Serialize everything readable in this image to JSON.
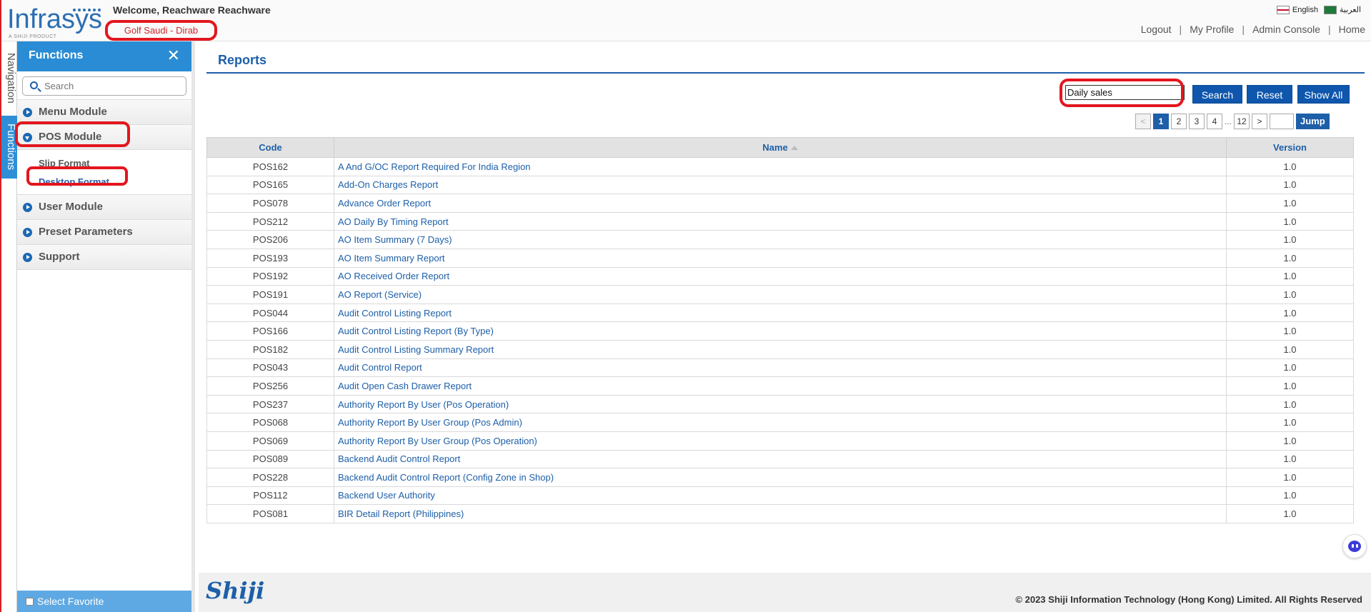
{
  "header": {
    "brand": "Infrasys",
    "brand_tag": "A SHIJI PRODUCT",
    "welcome": "Welcome, Reachware Reachware",
    "outlet": "Golf Saudi - Dirab",
    "languages": [
      "English",
      "العربية"
    ],
    "nav": [
      "Logout",
      "My Profile",
      "Admin Console",
      "Home"
    ]
  },
  "vtabs": {
    "navigation": "Navigation",
    "functions": "Functions"
  },
  "sidebar": {
    "title": "Functions",
    "search_placeholder": "Search",
    "modules": [
      {
        "label": "Menu Module",
        "open": false
      },
      {
        "label": "POS Module",
        "open": true,
        "items": [
          "Slip Format",
          "Desktop Format"
        ],
        "active_item": "Desktop Format"
      },
      {
        "label": "User Module",
        "open": false
      },
      {
        "label": "Preset Parameters",
        "open": false
      },
      {
        "label": "Support",
        "open": false
      }
    ],
    "favorite_label": "Select Favorite"
  },
  "main": {
    "title": "Reports",
    "search_value": "Daily sales",
    "buttons": {
      "search": "Search",
      "reset": "Reset",
      "show_all": "Show All"
    },
    "pager": {
      "prev": "<",
      "pages": [
        "1",
        "2",
        "3",
        "4"
      ],
      "ellipsis": "...",
      "last": "12",
      "next": ">",
      "current": "1",
      "jump": "Jump"
    },
    "table": {
      "columns": [
        "Code",
        "Name",
        "Version"
      ],
      "sort_column": "Name",
      "rows": [
        [
          "POS162",
          "A And G/OC Report Required For India Region",
          "1.0"
        ],
        [
          "POS165",
          "Add-On Charges Report",
          "1.0"
        ],
        [
          "POS078",
          "Advance Order Report",
          "1.0"
        ],
        [
          "POS212",
          "AO Daily By Timing Report",
          "1.0"
        ],
        [
          "POS206",
          "AO Item Summary (7 Days)",
          "1.0"
        ],
        [
          "POS193",
          "AO Item Summary Report",
          "1.0"
        ],
        [
          "POS192",
          "AO Received Order Report",
          "1.0"
        ],
        [
          "POS191",
          "AO Report (Service)",
          "1.0"
        ],
        [
          "POS044",
          "Audit Control Listing Report",
          "1.0"
        ],
        [
          "POS166",
          "Audit Control Listing Report (By Type)",
          "1.0"
        ],
        [
          "POS182",
          "Audit Control Listing Summary Report",
          "1.0"
        ],
        [
          "POS043",
          "Audit Control Report",
          "1.0"
        ],
        [
          "POS256",
          "Audit Open Cash Drawer Report",
          "1.0"
        ],
        [
          "POS237",
          "Authority Report By User (Pos Operation)",
          "1.0"
        ],
        [
          "POS068",
          "Authority Report By User Group (Pos Admin)",
          "1.0"
        ],
        [
          "POS069",
          "Authority Report By User Group (Pos Operation)",
          "1.0"
        ],
        [
          "POS089",
          "Backend Audit Control Report",
          "1.0"
        ],
        [
          "POS228",
          "Backend Audit Control Report (Config Zone in Shop)",
          "1.0"
        ],
        [
          "POS112",
          "Backend User Authority",
          "1.0"
        ],
        [
          "POS081",
          "BIR Detail Report (Philippines)",
          "1.0"
        ]
      ]
    }
  },
  "footer": {
    "logo": "Shiji",
    "copyright": "© 2023 Shiji Information Technology (Hong Kong) Limited. All Rights Reserved"
  },
  "colors": {
    "accent": "#1d5fa8",
    "sidebar_header": "#2a8cd4",
    "highlight": "#e3161e"
  }
}
